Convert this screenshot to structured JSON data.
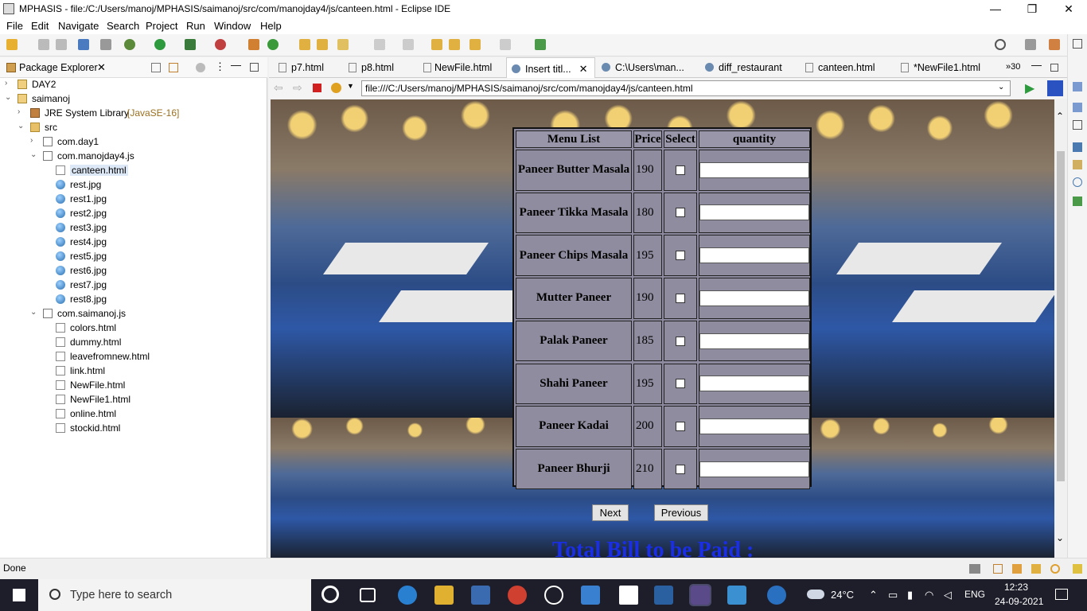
{
  "window": {
    "title": "MPHASIS - file:/C:/Users/manoj/MPHASIS/saimanoj/src/com/manojday4/js/canteen.html - Eclipse IDE",
    "minimize": "—",
    "maximize": "❐",
    "close": "✕"
  },
  "menu": [
    "File",
    "Edit",
    "Navigate",
    "Search",
    "Project",
    "Run",
    "Window",
    "Help"
  ],
  "package_explorer": {
    "title": "Package Explorer",
    "tree": [
      {
        "label": "DAY2",
        "indent": 0,
        "arrow": "›",
        "icon": "project"
      },
      {
        "label": "saimanoj",
        "indent": 0,
        "arrow": "⌄",
        "icon": "project"
      },
      {
        "label": "JRE System Library",
        "suffix": "[JavaSE-16]",
        "indent": 1,
        "arrow": "›",
        "icon": "lib"
      },
      {
        "label": "src",
        "indent": 1,
        "arrow": "⌄",
        "icon": "folder"
      },
      {
        "label": "com.day1",
        "indent": 2,
        "arrow": "›",
        "icon": "pkg"
      },
      {
        "label": "com.manojday4.js",
        "indent": 2,
        "arrow": "⌄",
        "icon": "pkg"
      },
      {
        "label": "canteen.html",
        "indent": 3,
        "arrow": "",
        "icon": "file",
        "selected": true
      },
      {
        "label": "rest.jpg",
        "indent": 3,
        "arrow": "",
        "icon": "globe"
      },
      {
        "label": "rest1.jpg",
        "indent": 3,
        "arrow": "",
        "icon": "globe"
      },
      {
        "label": "rest2.jpg",
        "indent": 3,
        "arrow": "",
        "icon": "globe"
      },
      {
        "label": "rest3.jpg",
        "indent": 3,
        "arrow": "",
        "icon": "globe"
      },
      {
        "label": "rest4.jpg",
        "indent": 3,
        "arrow": "",
        "icon": "globe"
      },
      {
        "label": "rest5.jpg",
        "indent": 3,
        "arrow": "",
        "icon": "globe"
      },
      {
        "label": "rest6.jpg",
        "indent": 3,
        "arrow": "",
        "icon": "globe"
      },
      {
        "label": "rest7.jpg",
        "indent": 3,
        "arrow": "",
        "icon": "globe"
      },
      {
        "label": "rest8.jpg",
        "indent": 3,
        "arrow": "",
        "icon": "globe"
      },
      {
        "label": "com.saimanoj.js",
        "indent": 2,
        "arrow": "⌄",
        "icon": "pkg"
      },
      {
        "label": "colors.html",
        "indent": 3,
        "arrow": "",
        "icon": "file"
      },
      {
        "label": "dummy.html",
        "indent": 3,
        "arrow": "",
        "icon": "file"
      },
      {
        "label": "leavefromnew.html",
        "indent": 3,
        "arrow": "",
        "icon": "file"
      },
      {
        "label": "link.html",
        "indent": 3,
        "arrow": "",
        "icon": "file"
      },
      {
        "label": "NewFile.html",
        "indent": 3,
        "arrow": "",
        "icon": "file"
      },
      {
        "label": "NewFile1.html",
        "indent": 3,
        "arrow": "",
        "icon": "file"
      },
      {
        "label": "online.html",
        "indent": 3,
        "arrow": "",
        "icon": "file"
      },
      {
        "label": "stockid.html",
        "indent": 3,
        "arrow": "",
        "icon": "file"
      }
    ]
  },
  "editor_tabs": [
    {
      "label": "p7.html",
      "active": false
    },
    {
      "label": "p8.html",
      "active": false
    },
    {
      "label": "NewFile.html",
      "active": false
    },
    {
      "label": "Insert titl...",
      "active": true,
      "close": "✕"
    },
    {
      "label": "C:\\Users\\man...",
      "active": false
    },
    {
      "label": "diff_restaurant",
      "active": false
    },
    {
      "label": "canteen.html",
      "active": false
    },
    {
      "label": "*NewFile1.html",
      "active": false
    }
  ],
  "overflow_count": "»30",
  "browser": {
    "url": "file:///C:/Users/manoj/MPHASIS/saimanoj/src/com/manojday4/js/canteen.html"
  },
  "menu_table": {
    "headers": [
      "Menu List",
      "Price",
      "Select",
      "quantity"
    ],
    "rows": [
      {
        "name": "Paneer Butter Masala",
        "price": "190"
      },
      {
        "name": "Paneer Tikka Masala",
        "price": "180"
      },
      {
        "name": "Paneer Chips Masala",
        "price": "195"
      },
      {
        "name": "Mutter Paneer",
        "price": "190"
      },
      {
        "name": "Palak Paneer",
        "price": "185"
      },
      {
        "name": "Shahi Paneer",
        "price": "195"
      },
      {
        "name": "Paneer Kadai",
        "price": "200"
      },
      {
        "name": "Paneer Bhurji",
        "price": "210"
      }
    ]
  },
  "buttons": {
    "next": "Next",
    "previous": "Previous"
  },
  "total_bill": "Total Bill to be Paid :",
  "status": "Done",
  "taskbar": {
    "search_placeholder": "Type here to search",
    "weather": "24°C",
    "language": "ENG",
    "time": "12:23",
    "date": "24-09-2021"
  }
}
